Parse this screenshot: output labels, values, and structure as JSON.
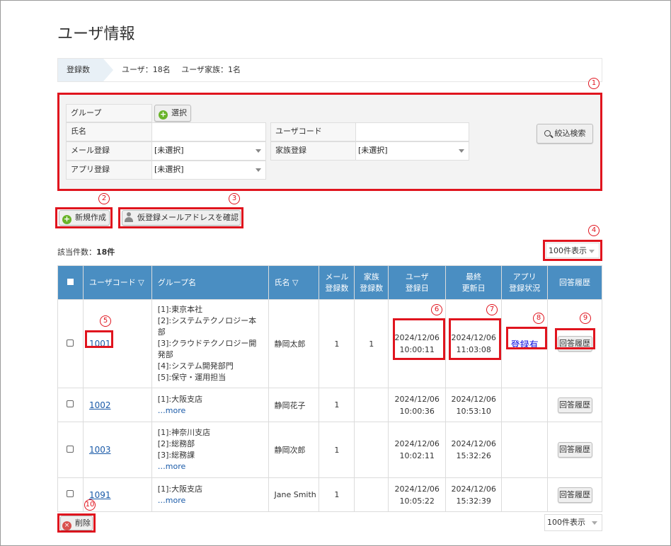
{
  "page": {
    "title": "ユーザ情報"
  },
  "count_bar": {
    "label": "登録数",
    "users": "ユーザ：18名",
    "families": "ユーザ家族：1名"
  },
  "markers": [
    "1",
    "2",
    "3",
    "4",
    "5",
    "6",
    "7",
    "8",
    "9",
    "10"
  ],
  "search": {
    "group_label": "グループ",
    "select_button": "選択",
    "name_label": "氏名",
    "name_value": "",
    "user_code_label": "ユーザコード",
    "user_code_value": "",
    "mail_label": "メール登録",
    "mail_value": "[未選択]",
    "family_label": "家族登録",
    "family_value": "[未選択]",
    "app_label": "アプリ登録",
    "app_value": "[未選択]",
    "search_button": "絞込検索"
  },
  "actions": {
    "new_button": "新規作成",
    "provisional_button": "仮登録メールアドレスを確認",
    "delete_button": "削除"
  },
  "list": {
    "count_label": "該当件数：",
    "count_value": "18件",
    "per_page": "100件表示",
    "headers": {
      "user_code": "ユーザコード ▽",
      "group": "グループ名",
      "name": "氏名 ▽",
      "mail": [
        "メール",
        "登録数"
      ],
      "family": [
        "家族",
        "登録数"
      ],
      "registered": [
        "ユーザ",
        "登録日"
      ],
      "updated": [
        "最終",
        "更新日"
      ],
      "app": [
        "アプリ",
        "登録状況"
      ],
      "history": "回答履歴"
    },
    "rows": [
      {
        "code": "1001",
        "groups": [
          "[1]:東京本社",
          "[2]:システムテクノロジー本部",
          "[3]:クラウドテクノロジー開発部",
          "[4]:システム開発部門",
          "[5]:保守・運用担当"
        ],
        "more": "",
        "name": "静岡太郎",
        "mail": "1",
        "family": "1",
        "reg_date": "2024/12/06",
        "reg_time": "10:00:11",
        "upd_date": "2024/12/06",
        "upd_time": "11:03:08",
        "app": "登録有",
        "history": "回答履歴"
      },
      {
        "code": "1002",
        "groups": [
          "[1]:大阪支店"
        ],
        "more": "…more",
        "name": "静岡花子",
        "mail": "1",
        "family": "",
        "reg_date": "2024/12/06",
        "reg_time": "10:00:36",
        "upd_date": "2024/12/06",
        "upd_time": "10:53:10",
        "app": "",
        "history": "回答履歴"
      },
      {
        "code": "1003",
        "groups": [
          "[1]:神奈川支店",
          "[2]:総務部",
          "[3]:総務課"
        ],
        "more": "…more",
        "name": "静岡次郎",
        "mail": "1",
        "family": "",
        "reg_date": "2024/12/06",
        "reg_time": "10:02:11",
        "upd_date": "2024/12/06",
        "upd_time": "15:32:26",
        "app": "",
        "history": "回答履歴"
      },
      {
        "code": "1091",
        "groups": [
          "[1]:大阪支店"
        ],
        "more": "…more",
        "name": "Jane Smith",
        "mail": "1",
        "family": "",
        "reg_date": "2024/12/06",
        "reg_time": "10:05:22",
        "upd_date": "2024/12/06",
        "upd_time": "15:32:39",
        "app": "",
        "history": "回答履歴"
      }
    ]
  },
  "colors": {
    "header_blue": "#4a8ec2",
    "annotation_red": "#e0141e",
    "link_blue": "#1a5aa8",
    "plus_green": "#6ab42a"
  }
}
